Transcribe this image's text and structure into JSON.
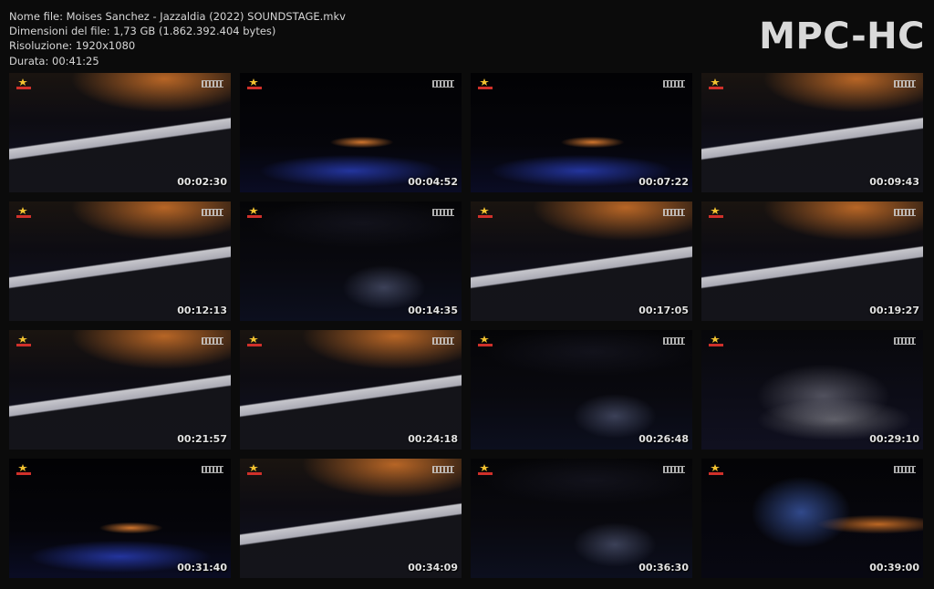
{
  "header": {
    "file_name": "Nome file: Moises Sanchez - Jazzaldia (2022) SOUNDSTAGE.mkv",
    "file_size": "Dimensioni del file: 1,73 GB (1.862.392.404 bytes)",
    "resolution": "Risoluzione: 1920x1080",
    "duration": "Durata: 00:41:25",
    "brand": "MPC-HC"
  },
  "thumbnails": [
    {
      "time": "00:02:30",
      "scene": "closeup"
    },
    {
      "time": "00:04:52",
      "scene": "stage"
    },
    {
      "time": "00:07:22",
      "scene": "stage"
    },
    {
      "time": "00:09:43",
      "scene": "closeup"
    },
    {
      "time": "00:12:13",
      "scene": "closeup"
    },
    {
      "time": "00:14:35",
      "scene": "wide"
    },
    {
      "time": "00:17:05",
      "scene": "closeup"
    },
    {
      "time": "00:19:27",
      "scene": "closeup"
    },
    {
      "time": "00:21:57",
      "scene": "closeup"
    },
    {
      "time": "00:24:18",
      "scene": "closeup"
    },
    {
      "time": "00:26:48",
      "scene": "wide"
    },
    {
      "time": "00:29:10",
      "scene": "side"
    },
    {
      "time": "00:31:40",
      "scene": "stage"
    },
    {
      "time": "00:34:09",
      "scene": "closeup"
    },
    {
      "time": "00:36:30",
      "scene": "wide"
    },
    {
      "time": "00:39:00",
      "scene": "portrait"
    }
  ]
}
